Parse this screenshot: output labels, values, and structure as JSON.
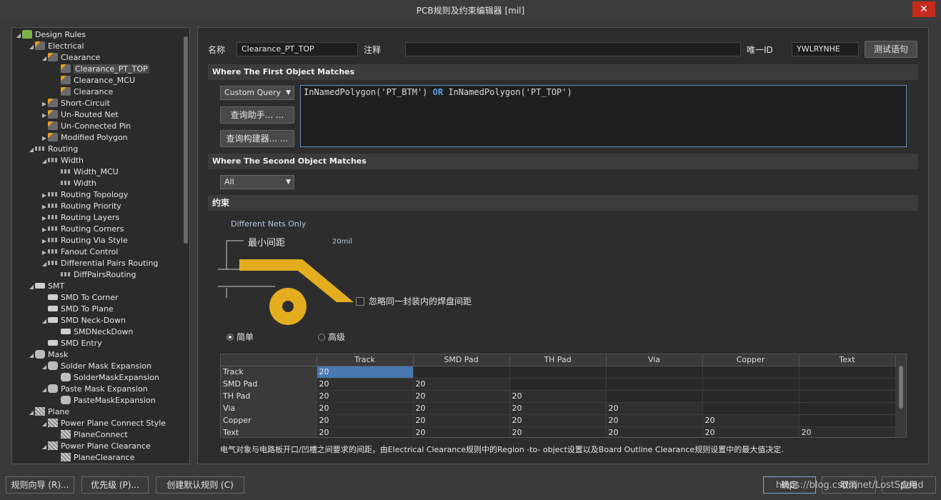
{
  "window": {
    "title": "PCB规则及约束编辑器 [mil]",
    "close": "✕"
  },
  "tree": {
    "items": [
      {
        "label": "Design Rules",
        "level": 0,
        "twisty": "◢",
        "icon": "folder-icon"
      },
      {
        "label": "Electrical",
        "level": 1,
        "twisty": "◢",
        "icon": "rule-icon"
      },
      {
        "label": "Clearance",
        "level": 2,
        "twisty": "◢",
        "icon": "rule-icon"
      },
      {
        "label": "Clearance_PT_TOP",
        "level": 3,
        "twisty": "",
        "icon": "rule-icon",
        "selected": true
      },
      {
        "label": "Clearance_MCU",
        "level": 3,
        "twisty": "",
        "icon": "rule-icon"
      },
      {
        "label": "Clearance",
        "level": 3,
        "twisty": "",
        "icon": "rule-icon"
      },
      {
        "label": "Short-Circuit",
        "level": 2,
        "twisty": "▶",
        "icon": "rule-icon"
      },
      {
        "label": "Un-Routed Net",
        "level": 2,
        "twisty": "▶",
        "icon": "rule-icon"
      },
      {
        "label": "Un-Connected Pin",
        "level": 2,
        "twisty": "",
        "icon": "rule-icon"
      },
      {
        "label": "Modified Polygon",
        "level": 2,
        "twisty": "▶",
        "icon": "rule-icon"
      },
      {
        "label": "Routing",
        "level": 1,
        "twisty": "◢",
        "icon": "route-icon"
      },
      {
        "label": "Width",
        "level": 2,
        "twisty": "◢",
        "icon": "route-icon"
      },
      {
        "label": "Width_MCU",
        "level": 3,
        "twisty": "",
        "icon": "route-icon"
      },
      {
        "label": "Width",
        "level": 3,
        "twisty": "",
        "icon": "route-icon"
      },
      {
        "label": "Routing Topology",
        "level": 2,
        "twisty": "▶",
        "icon": "route-icon"
      },
      {
        "label": "Routing Priority",
        "level": 2,
        "twisty": "▶",
        "icon": "route-icon"
      },
      {
        "label": "Routing Layers",
        "level": 2,
        "twisty": "▶",
        "icon": "route-icon"
      },
      {
        "label": "Routing Corners",
        "level": 2,
        "twisty": "▶",
        "icon": "route-icon"
      },
      {
        "label": "Routing Via Style",
        "level": 2,
        "twisty": "▶",
        "icon": "route-icon"
      },
      {
        "label": "Fanout Control",
        "level": 2,
        "twisty": "▶",
        "icon": "route-icon"
      },
      {
        "label": "Differential Pairs Routing",
        "level": 2,
        "twisty": "◢",
        "icon": "route-icon"
      },
      {
        "label": "DiffPairsRouting",
        "level": 3,
        "twisty": "",
        "icon": "route-icon"
      },
      {
        "label": "SMT",
        "level": 1,
        "twisty": "◢",
        "icon": "smt-icon"
      },
      {
        "label": "SMD To Corner",
        "level": 2,
        "twisty": "",
        "icon": "smt-icon"
      },
      {
        "label": "SMD To Plane",
        "level": 2,
        "twisty": "",
        "icon": "smt-icon"
      },
      {
        "label": "SMD Neck-Down",
        "level": 2,
        "twisty": "◢",
        "icon": "smt-icon"
      },
      {
        "label": "SMDNeckDown",
        "level": 3,
        "twisty": "",
        "icon": "smt-icon"
      },
      {
        "label": "SMD Entry",
        "level": 2,
        "twisty": "",
        "icon": "smt-icon"
      },
      {
        "label": "Mask",
        "level": 1,
        "twisty": "◢",
        "icon": "mask-icon"
      },
      {
        "label": "Solder Mask Expansion",
        "level": 2,
        "twisty": "◢",
        "icon": "mask-icon"
      },
      {
        "label": "SolderMaskExpansion",
        "level": 3,
        "twisty": "",
        "icon": "mask-icon"
      },
      {
        "label": "Paste Mask Expansion",
        "level": 2,
        "twisty": "◢",
        "icon": "mask-icon"
      },
      {
        "label": "PasteMaskExpansion",
        "level": 3,
        "twisty": "",
        "icon": "mask-icon"
      },
      {
        "label": "Plane",
        "level": 1,
        "twisty": "◢",
        "icon": "plane-icon"
      },
      {
        "label": "Power Plane Connect Style",
        "level": 2,
        "twisty": "◢",
        "icon": "plane-icon"
      },
      {
        "label": "PlaneConnect",
        "level": 3,
        "twisty": "",
        "icon": "plane-icon"
      },
      {
        "label": "Power Plane Clearance",
        "level": 2,
        "twisty": "◢",
        "icon": "plane-icon"
      },
      {
        "label": "PlaneClearance",
        "level": 3,
        "twisty": "",
        "icon": "plane-icon"
      }
    ]
  },
  "rule": {
    "name_label": "名称",
    "name_value": "Clearance_PT_TOP",
    "comment_label": "注释",
    "comment_value": "",
    "uid_label": "唯一ID",
    "uid_value": "YWLRYNHE",
    "test_button": "测试语句"
  },
  "first_match": {
    "header": "Where The First Object Matches",
    "combo": "Custom Query",
    "query_helper_button": "查询助手... ...",
    "query_builder_button": "查询构建器... ...",
    "query": {
      "part1": "InNamedPolygon('PT_BTM')",
      "op": "OR",
      "part2": "InNamedPolygon('PT_TOP')"
    }
  },
  "second_match": {
    "header": "Where The Second Object Matches",
    "combo": "All"
  },
  "constraints": {
    "header": "约束",
    "net_scope": "Different Nets Only",
    "min_clearance_label": "最小间距",
    "min_clearance_value": "20mil",
    "ignore_pad_label": "忽略同一封装内的焊盘间距",
    "radio_simple": "简单",
    "radio_advanced": "高级",
    "colors": {
      "copper": "#e3ad1f"
    }
  },
  "grid": {
    "columns": [
      "Track",
      "SMD Pad",
      "TH Pad",
      "Via",
      "Copper",
      "Text"
    ],
    "rows": [
      {
        "label": "Track",
        "cells": [
          "20",
          null,
          null,
          null,
          null,
          null
        ]
      },
      {
        "label": "SMD Pad",
        "cells": [
          "20",
          "20",
          null,
          null,
          null,
          null
        ]
      },
      {
        "label": "TH Pad",
        "cells": [
          "20",
          "20",
          "20",
          null,
          null,
          null
        ]
      },
      {
        "label": "Via",
        "cells": [
          "20",
          "20",
          "20",
          "20",
          null,
          null
        ]
      },
      {
        "label": "Copper",
        "cells": [
          "20",
          "20",
          "20",
          "20",
          "20",
          null
        ]
      },
      {
        "label": "Text",
        "cells": [
          "20",
          "20",
          "20",
          "20",
          "20",
          "20"
        ]
      }
    ],
    "note": "电气对象与电路板开口/凹槽之间要求的间距，由Electrical Clearance规则中的Region -to- object设置以及Board Outline Clearance规则设置中的最大值决定."
  },
  "footer": {
    "wizard": "规则向导 (R)...",
    "priority": "优先级 (P)...",
    "create_default": "创建默认规则 (C)",
    "ok": "确定",
    "cancel": "取消",
    "apply": "应用",
    "watermark": "https://blog.csdn.net/LostSpeed"
  }
}
